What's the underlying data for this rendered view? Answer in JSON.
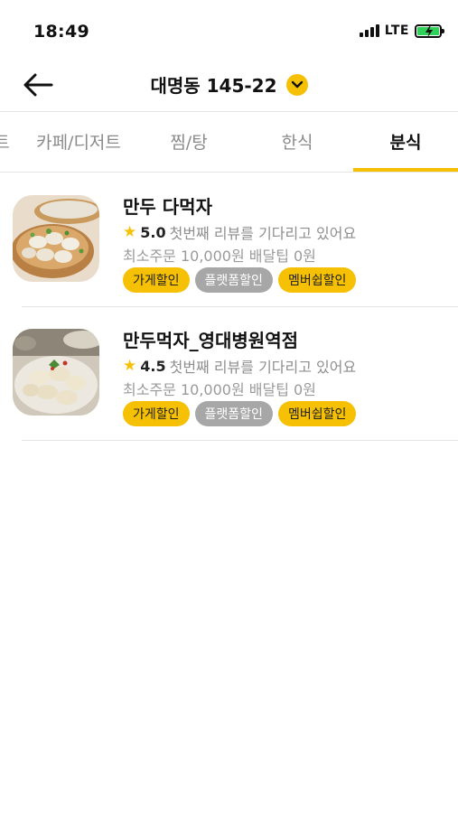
{
  "status_bar": {
    "time": "18:49",
    "network": "LTE"
  },
  "header": {
    "location": "대명동 145-22"
  },
  "tabs": [
    {
      "label": "트"
    },
    {
      "label": "카페/디저트"
    },
    {
      "label": "찜/탕"
    },
    {
      "label": "한식"
    },
    {
      "label": "분식"
    }
  ],
  "active_tab": "분식",
  "stores": [
    {
      "name": "만두 다먹자",
      "rating": "5.0",
      "review_text": "첫번째 리뷰를 기다리고 있어요",
      "meta": "최소주문 10,000원 배달팁 0원",
      "badges": [
        "가게할인",
        "플랫폼할인",
        "멤버쉽할인"
      ]
    },
    {
      "name": "만두먹자_영대병원역점",
      "rating": "4.5",
      "review_text": "첫번째 리뷰를 기다리고 있어요",
      "meta": "최소주문 10,000원 배달팁 0원",
      "badges": [
        "가게할인",
        "플랫폼할인",
        "멤버쉽할인"
      ]
    }
  ],
  "colors": {
    "accent": "#f6c104",
    "badge_gray": "#a7a7a7",
    "battery": "#2fd158"
  }
}
